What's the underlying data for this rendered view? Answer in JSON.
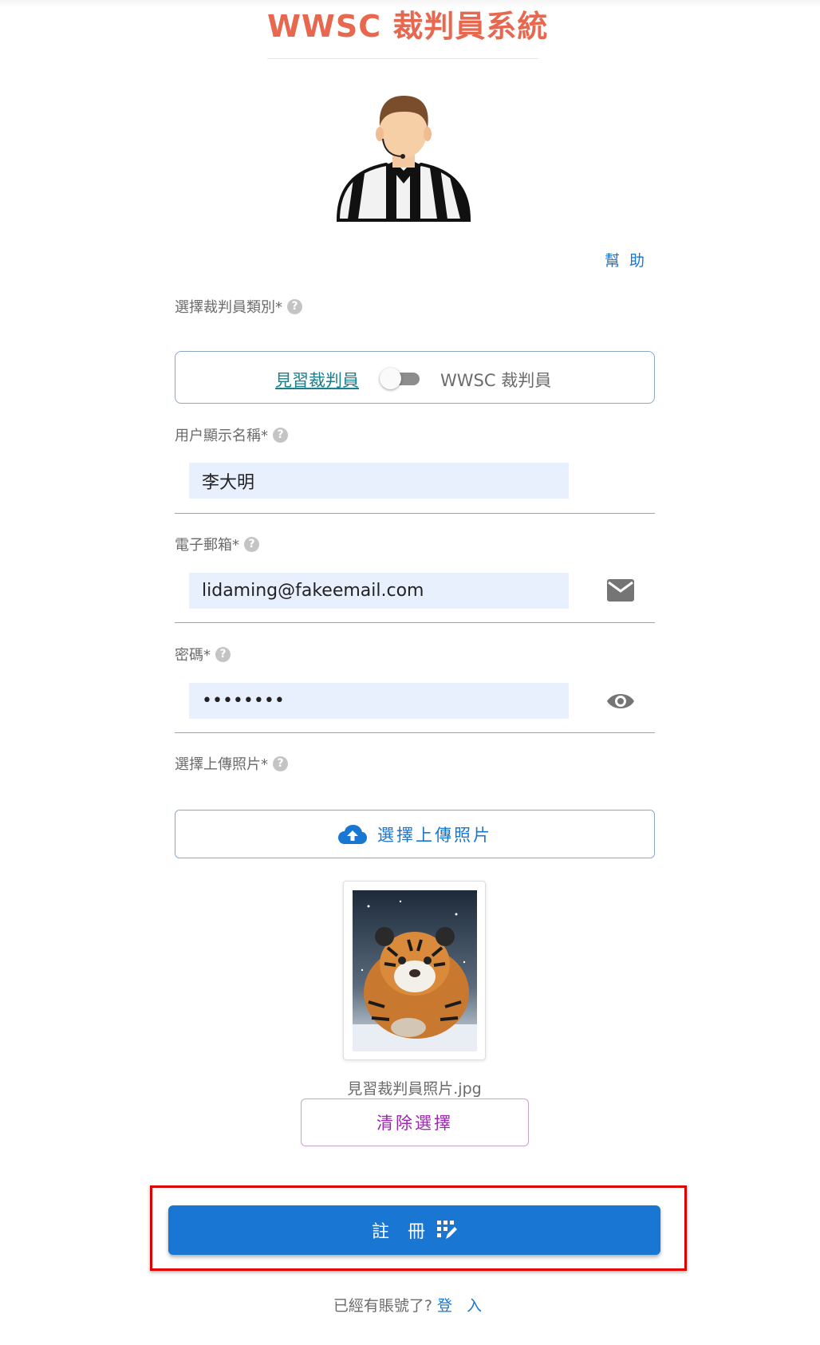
{
  "header": {
    "title": "WWSC 裁判員系統"
  },
  "help": {
    "label": "幫 助"
  },
  "referee_type": {
    "label": "選擇裁判員類別*",
    "option_left": "見習裁判員",
    "option_right": "WWSC 裁判員",
    "selected": "見習裁判員"
  },
  "display_name": {
    "label": "用户顯示名稱*",
    "value": "李大明"
  },
  "email": {
    "label": "電子郵箱*",
    "value": "lidaming@fakeemail.com",
    "icon": "mail-icon"
  },
  "password": {
    "label": "密碼*",
    "value": "••••••••",
    "icon": "eye-icon"
  },
  "photo": {
    "label": "選擇上傳照片*",
    "upload_label": "選擇上傳照片",
    "filename": "見習裁判員照片.jpg",
    "clear_label": "清除選擇"
  },
  "register": {
    "label": "註 冊"
  },
  "footer": {
    "question": "已經有賬號了?",
    "login_label": "登 入"
  },
  "help_icon_glyph": "?",
  "colors": {
    "title": "#e8674f",
    "primary": "#1976d2",
    "highlight": "#e00000",
    "clear": "#9c27b0",
    "input_bg": "#e8f0fe"
  }
}
